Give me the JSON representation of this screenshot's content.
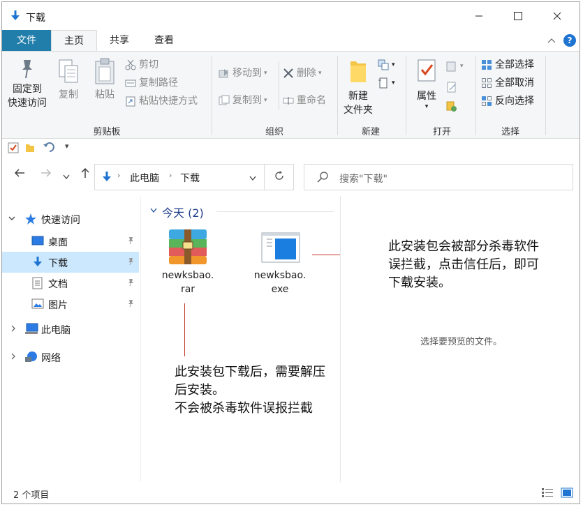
{
  "window": {
    "title": "下载"
  },
  "tabs": [
    {
      "label": "文件"
    },
    {
      "label": "主页"
    },
    {
      "label": "共享"
    },
    {
      "label": "查看"
    }
  ],
  "ribbon": {
    "clipboard": {
      "pin_quick_access": "固定到\n快速访问",
      "copy": "复制",
      "paste": "粘贴",
      "cut": "剪切",
      "copy_path": "复制路径",
      "paste_shortcut": "粘贴快捷方式",
      "group_label": "剪贴板"
    },
    "organize": {
      "move_to": "移动到",
      "copy_to": "复制到",
      "delete": "删除",
      "rename": "重命名",
      "group_label": "组织"
    },
    "new": {
      "new_folder": "新建\n文件夹",
      "group_label": "新建"
    },
    "open": {
      "properties": "属性",
      "group_label": "打开"
    },
    "select": {
      "select_all": "全部选择",
      "select_none": "全部取消",
      "invert_selection": "反向选择",
      "group_label": "选择"
    }
  },
  "address": {
    "crumbs": [
      "此电脑",
      "下载"
    ],
    "search_placeholder": "搜索\"下载\""
  },
  "nav": {
    "quick_access": "快速访问",
    "items": [
      {
        "label": "桌面"
      },
      {
        "label": "下载"
      },
      {
        "label": "文档"
      },
      {
        "label": "图片"
      }
    ],
    "this_pc": "此电脑",
    "network": "网络"
  },
  "content": {
    "group_header": "今天 (2)",
    "files": [
      {
        "name": "newksbao.\nrar",
        "type": "rar"
      },
      {
        "name": "newksbao.\nexe",
        "type": "exe"
      }
    ]
  },
  "preview": {
    "text": "选择要预览的文件。"
  },
  "status": {
    "count": "2 个项目"
  },
  "annotations": {
    "exe_note": "此安装包会被部分杀毒软件\n误拦截，点击信任后，即可\n下载安装。",
    "rar_note": "此安装包下载后，需要解压\n后安装。\n不会被杀毒软件误报拦截"
  },
  "colors": {
    "accent": "#217eab",
    "selected": "#cce8ff",
    "annotation_line": "#c0392b"
  }
}
